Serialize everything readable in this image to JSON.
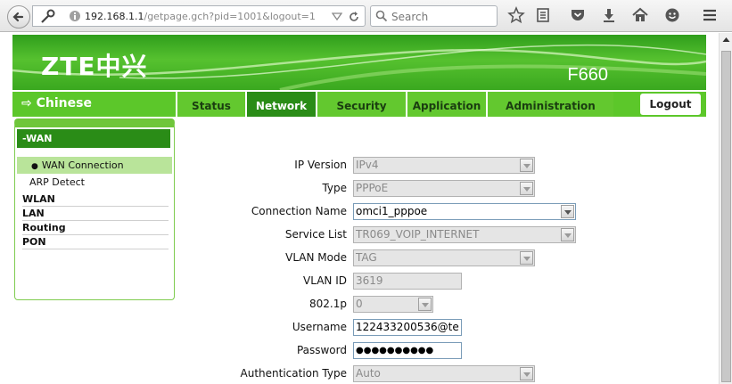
{
  "browser": {
    "url_host": "192.168.1.1",
    "url_path": "/getpage.gch?pid=1001&logout=1",
    "search_placeholder": "Search"
  },
  "header": {
    "logo": "ZTE中兴",
    "model": "F660"
  },
  "nav": {
    "language": "⇨ Chinese",
    "tabs": [
      "Status",
      "Network",
      "Security",
      "Application",
      "Administration"
    ],
    "active_tab": "Network",
    "logout": "Logout"
  },
  "sidebar": {
    "section": "-WAN",
    "items": [
      "WAN Connection",
      "ARP Detect"
    ],
    "active_item": "WAN Connection",
    "categories": [
      "WLAN",
      "LAN",
      "Routing",
      "PON"
    ]
  },
  "form": {
    "rows": [
      {
        "label": "IP Version",
        "value": "IPv4",
        "kind": "select",
        "enabled": false
      },
      {
        "label": "Type",
        "value": "PPPoE",
        "kind": "select",
        "enabled": false
      },
      {
        "label": "Connection Name",
        "value": "omci1_pppoe",
        "kind": "select",
        "enabled": true
      },
      {
        "label": "Service List",
        "value": "TR069_VOIP_INTERNET",
        "kind": "select",
        "enabled": false
      },
      {
        "label": "VLAN Mode",
        "value": "TAG",
        "kind": "select",
        "enabled": false
      },
      {
        "label": "VLAN ID",
        "value": "3619",
        "kind": "text",
        "enabled": false
      },
      {
        "label": "802.1p",
        "value": "0",
        "kind": "select",
        "enabled": false
      },
      {
        "label": "Username",
        "value": "122433200536@te",
        "kind": "text",
        "enabled": true
      },
      {
        "label": "Password",
        "value": "●●●●●●●●●●",
        "kind": "password",
        "enabled": true
      },
      {
        "label": "Authentication Type",
        "value": "Auto",
        "kind": "select",
        "enabled": false
      }
    ]
  },
  "colors": {
    "brand_green": "#5cc72a",
    "active_green": "#2a8c17"
  }
}
